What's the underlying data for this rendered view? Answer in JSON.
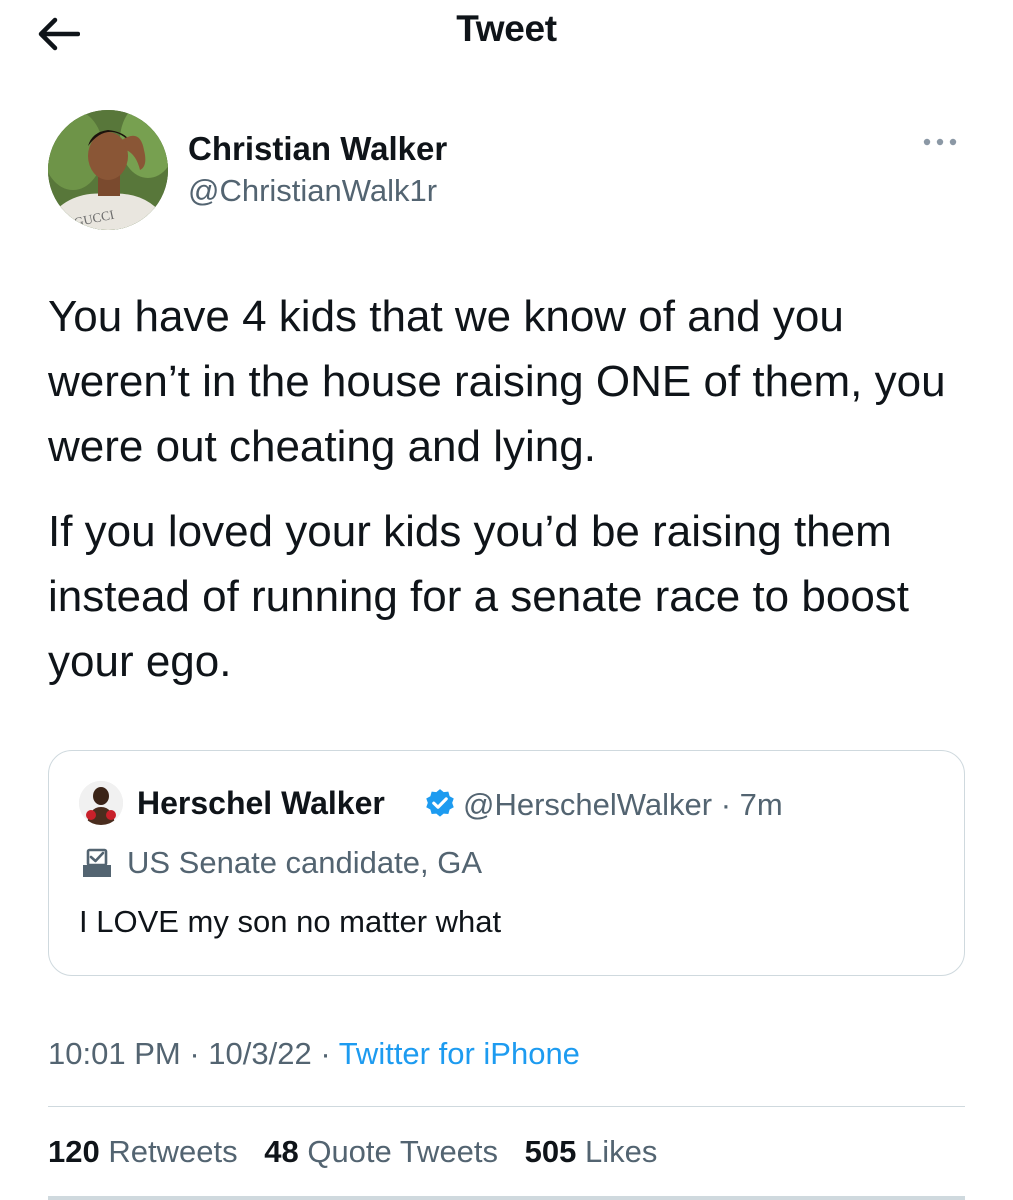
{
  "header": {
    "title": "Tweet",
    "back_icon": "arrow-left-icon"
  },
  "author": {
    "name": "Christian Walker",
    "handle": "@ChristianWalk1r",
    "avatar_shirt_text": "GUCCI"
  },
  "tweet": {
    "paragraphs": [
      "You have 4 kids that we know of and you weren’t in the house raising ONE of them, you were out cheating and lying.",
      "If you loved your kids you’d be raising them instead of running for a senate race to boost your ego."
    ]
  },
  "quoted_tweet": {
    "name": "Herschel Walker",
    "handle_time": "@HerschelWalker · 7m",
    "verified": true,
    "label": "US Senate candidate, GA",
    "text": "I LOVE my son no matter what"
  },
  "meta": {
    "time": "10:01 PM",
    "separator": " · ",
    "date": "10/3/22",
    "source": "Twitter for iPhone"
  },
  "stats": {
    "retweets_count": "120",
    "retweets_label": "Retweets",
    "quotes_count": "48",
    "quotes_label": "Quote Tweets",
    "likes_count": "505",
    "likes_label": "Likes"
  },
  "colors": {
    "accent": "#1d9bf0",
    "text": "#0f1419",
    "secondary": "#536471",
    "border": "#cfd9de"
  }
}
